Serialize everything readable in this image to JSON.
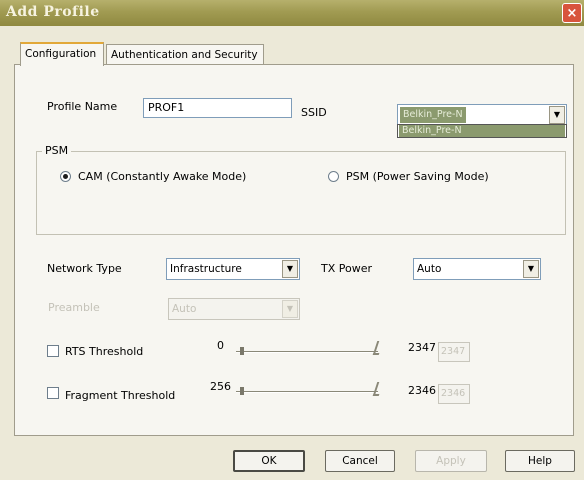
{
  "window": {
    "title": "Add Profile",
    "close_glyph": "×"
  },
  "tabs": [
    {
      "label": "Configuration",
      "active": true
    },
    {
      "label": "Authentication and Security",
      "active": false
    }
  ],
  "profile": {
    "name_label": "Profile Name",
    "name_value": "PROF1",
    "ssid_label": "SSID",
    "ssid_value": "Belkin_Pre-N",
    "ssid_options": [
      "Belkin_Pre-N"
    ]
  },
  "psm": {
    "group_label": "PSM",
    "options": [
      {
        "label": "CAM (Constantly Awake Mode)",
        "selected": true
      },
      {
        "label": "PSM (Power Saving Mode)",
        "selected": false
      }
    ]
  },
  "network": {
    "type_label": "Network Type",
    "type_value": "Infrastructure",
    "tx_label": "TX Power",
    "tx_value": "Auto",
    "preamble_label": "Preamble",
    "preamble_value": "Auto"
  },
  "rts": {
    "label": "RTS Threshold",
    "checked": false,
    "min": "0",
    "max": "2347",
    "value": "2347",
    "level": 0
  },
  "fragment": {
    "label": "Fragment Threshold",
    "checked": false,
    "min": "256",
    "max": "2346",
    "value": "2346",
    "level": 0
  },
  "buttons": {
    "ok": "OK",
    "cancel": "Cancel",
    "apply": "Apply",
    "help": "Help"
  },
  "icons": {
    "dropdown": "chevron-down-icon",
    "close": "close-icon"
  },
  "colors": {
    "titlebar": "#a19b52",
    "selection": "#8b9a6e",
    "close": "#d8543c"
  }
}
